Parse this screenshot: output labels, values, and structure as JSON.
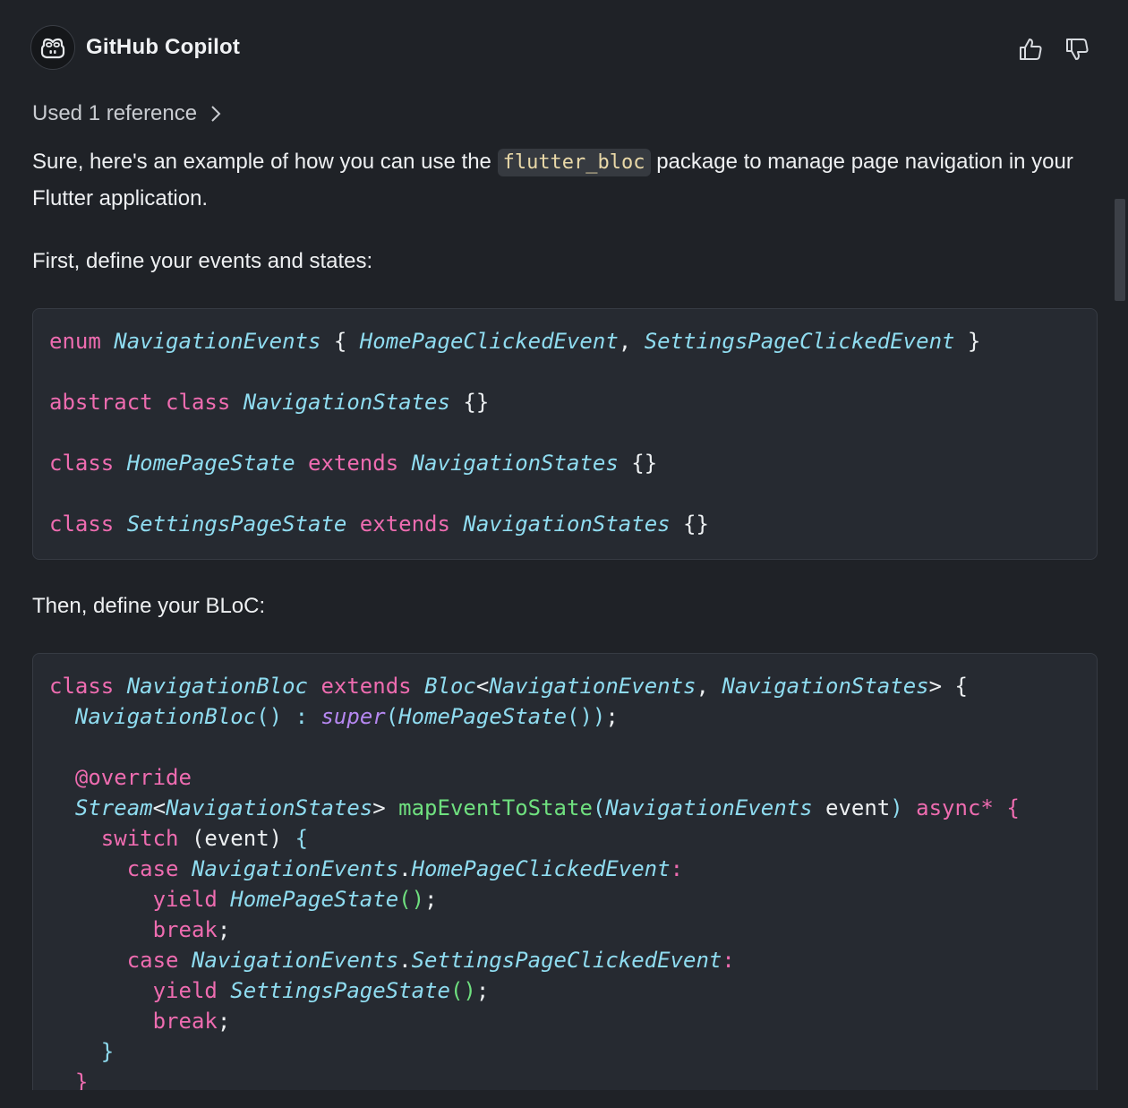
{
  "header": {
    "title": "GitHub Copilot",
    "avatar_icon": "copilot-icon",
    "like_icon": "thumbs-up-icon",
    "dislike_icon": "thumbs-down-icon"
  },
  "references": {
    "label": "Used 1 reference",
    "icon": "chevron-right-icon"
  },
  "message": {
    "intro_before": "Sure, here's an example of how you can use the",
    "intro_code": "flutter_bloc",
    "intro_after": "package to manage page navigation in your Flutter application.",
    "step1": "First, define your events and states:",
    "step2": "Then, define your BLoC:"
  },
  "code_block_1": {
    "line1": {
      "t1": "enum",
      "t2": "NavigationEvents",
      "t3": "{",
      "t4": "HomePageClickedEvent",
      "t5": ",",
      "t6": "SettingsPageClickedEvent",
      "t7": "}"
    },
    "line2": {
      "t1": "abstract",
      "t2": "class",
      "t3": "NavigationStates",
      "t4": "{}"
    },
    "line3": {
      "t1": "class",
      "t2": "HomePageState",
      "t3": "extends",
      "t4": "NavigationStates",
      "t5": "{}"
    },
    "line4": {
      "t1": "class",
      "t2": "SettingsPageState",
      "t3": "extends",
      "t4": "NavigationStates",
      "t5": "{}"
    }
  },
  "code_block_2": {
    "l1": {
      "a": "class",
      "b": "NavigationBloc",
      "c": "extends",
      "d": "Bloc",
      "e": "<",
      "f": "NavigationEvents",
      "g": ",",
      "h": "NavigationStates",
      "i": "> {"
    },
    "l2": {
      "a": "NavigationBloc",
      "b": "()",
      "c": ":",
      "d": "super",
      "e": "(",
      "f": "HomePageState",
      "g": "()",
      "h": ")",
      "i": ";"
    },
    "l3": {
      "a": "@override"
    },
    "l4": {
      "a": "Stream",
      "b": "<",
      "c": "NavigationStates",
      "d": ">",
      "e": "mapEventToState",
      "f": "(",
      "g": "NavigationEvents",
      "h": "event",
      "i": ")",
      "j": "async*",
      "k": "{"
    },
    "l5": {
      "a": "switch",
      "b": "(event)",
      "c": "{"
    },
    "l6": {
      "a": "case",
      "b": "NavigationEvents",
      "c": ".",
      "d": "HomePageClickedEvent",
      "e": ":"
    },
    "l7": {
      "a": "yield",
      "b": "HomePageState",
      "c": "()",
      "d": ";"
    },
    "l8": {
      "a": "break",
      "b": ";"
    },
    "l9": {
      "a": "case",
      "b": "NavigationEvents",
      "c": ".",
      "d": "SettingsPageClickedEvent",
      "e": ":"
    },
    "l10": {
      "a": "yield",
      "b": "SettingsPageState",
      "c": "()",
      "d": ";"
    },
    "l11": {
      "a": "break",
      "b": ";"
    },
    "l12": {
      "a": "}"
    },
    "l13": {
      "a": "}"
    }
  },
  "colors": {
    "background": "#1f2227",
    "code_background": "#262a31",
    "keyword": "#ee6cb0",
    "type": "#8fdcf0",
    "function": "#6fe07f",
    "super": "#b587f0",
    "inline_code_text": "#ead9a8"
  }
}
